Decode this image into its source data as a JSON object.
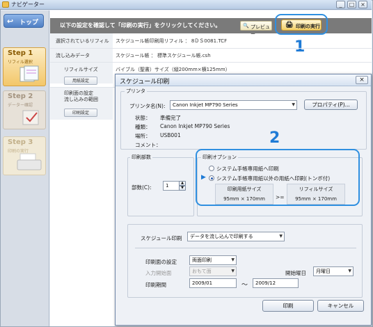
{
  "navigator": {
    "title": "ナビゲーター",
    "top_button": "トップ",
    "steps": [
      {
        "title": "Step 1",
        "subtitle": "リフィル選択"
      },
      {
        "title": "Step 2",
        "subtitle": "データー確認"
      },
      {
        "title": "Step 3",
        "subtitle": "印刷の実行"
      }
    ],
    "banner_text": "以下の設定を確認して「印刷の実行」をクリックしてください。",
    "preview_button": "プレビュー",
    "print_exec_button": "印刷の実行",
    "callout_1": "1",
    "rows": [
      {
        "label": "選択されているリフィル",
        "value": "スケジュール帳印刷用リフィル ： 8ＤＳ0081.TCF"
      },
      {
        "label": "流し込みデータ",
        "value": "スケジュール帳 ： 標準スケジュール帳.csh"
      },
      {
        "label": "リフィルサイズ",
        "value": "バイブル（聖書）サイズ（縦200mm×横125mm）",
        "button": "用紙設定"
      },
      {
        "label": "印刷面の設定\n流し込みの範囲",
        "button": "印刷設定"
      }
    ]
  },
  "dialog": {
    "title": "スケジュール印刷",
    "close": "×",
    "printer_group": "プリンタ",
    "printer_name_label": "プリンタ名(N):",
    "printer_name": "Canon Inkjet MP790 Series",
    "properties_button": "プロパティ(P)...",
    "status_label": "状態：",
    "status_value": "準備完了",
    "type_label": "種類：",
    "type_value": "Canon Inkjet MP790 Series",
    "location_label": "場所：",
    "location_value": "USB001",
    "comment_label": "コメント：",
    "copies_group": "印刷部数",
    "copies_label": "部数(C):",
    "copies_value": "1",
    "options_group": "印刷オプション",
    "option_1": "システム手帳専用紙へ印刷",
    "option_2": "システム手帳専用紙以外の用紙へ印刷(トンボ付)",
    "paper_size_label": "印刷用紙サイズ",
    "paper_size_value": "95mm × 170mm",
    "refill_size_label": "リフィルサイズ",
    "refill_size_value": "95mm × 170mm",
    "ge_symbol": ">=",
    "callout_2": "2",
    "schedule_label": "スケジュール印刷",
    "schedule_value": "データを流し込んで印刷する",
    "print_side_label": "印刷面の設定",
    "print_side_value": "両面印刷",
    "input_start_label": "入力開始面",
    "input_start_value": "おもて面",
    "start_day_label": "開始曜日",
    "start_day_value": "月曜日",
    "period_label": "印刷期間",
    "period_from": "2009/01",
    "period_sep": "～",
    "period_to": "2009/12",
    "print_button": "印刷",
    "cancel_button": "キャンセル"
  },
  "colors": {
    "accent_blue": "#1f7bd6",
    "step1": "#f3c76a"
  }
}
